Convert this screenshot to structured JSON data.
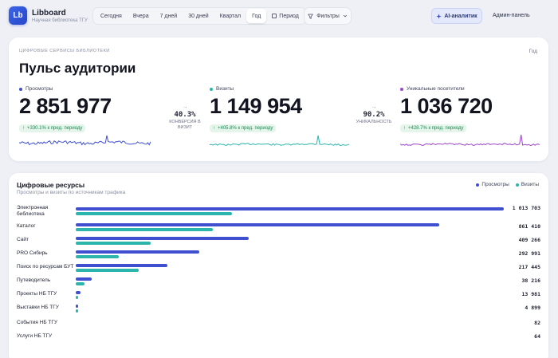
{
  "brand": {
    "logo": "Lb",
    "name": "Libboard",
    "subtitle": "Научная библиотека ТГУ"
  },
  "periods": [
    "Сегодня",
    "Вчера",
    "7 дней",
    "30 дней",
    "Квартал",
    "Год",
    "Период"
  ],
  "active_period": "Год",
  "toolbar": {
    "filters_label": "Фильтры",
    "ai_label": "AI-аналитик",
    "admin_label": "Админ-панель"
  },
  "pulse": {
    "eyebrow": "ЦИФРОВЫЕ СЕРВИСЫ БИБЛИОТЕКИ",
    "period": "Год",
    "title": "Пульс аудитории",
    "metrics": [
      {
        "label": "Просмотры",
        "value": "2 851 977",
        "delta": "+330.1% к пред. периоду",
        "color": "#3f4fd0"
      },
      {
        "label": "Визиты",
        "value": "1 149 954",
        "delta": "+405.8% к пред. периоду",
        "color": "#2bb5ad"
      },
      {
        "label": "Уникальные посетители",
        "value": "1 036 720",
        "delta": "+428.7% к пред. периоду",
        "color": "#9b45c9"
      }
    ],
    "conversions": [
      {
        "arrow": "→",
        "value": "40.3%",
        "label": "КОНВЕРСИЯ В ВИЗИТ"
      },
      {
        "arrow": "→",
        "value": "90.2%",
        "label": "УНИКАЛЬНОСТЬ"
      }
    ]
  },
  "resources": {
    "title": "Цифровые ресурсы",
    "subtitle": "Просмотры и визиты по источникам трафика",
    "legend": {
      "views": "Просмотры",
      "visits": "Визиты"
    },
    "rows": [
      {
        "label": "Электронная библиотека",
        "value": "1 013 703",
        "views": 1.0,
        "visits": 0.365
      },
      {
        "label": "Каталог",
        "value": "861 410",
        "views": 0.85,
        "visits": 0.32
      },
      {
        "label": "Сайт",
        "value": "409 266",
        "views": 0.404,
        "visits": 0.175
      },
      {
        "label": "PRO Сибирь",
        "value": "292 991",
        "views": 0.289,
        "visits": 0.1
      },
      {
        "label": "Поиск по ресурсам БУТ",
        "value": "217 445",
        "views": 0.215,
        "visits": 0.148
      },
      {
        "label": "Путеводитель",
        "value": "38 216",
        "views": 0.038,
        "visits": 0.02
      },
      {
        "label": "Проекты НБ ТГУ",
        "value": "13 981",
        "views": 0.012,
        "visits": 0.006
      },
      {
        "label": "Выставки НБ ТГУ",
        "value": "4 899",
        "views": 0.005,
        "visits": 0.003
      },
      {
        "label": "События НБ ТГУ",
        "value": "82",
        "views": 0,
        "visits": 0
      },
      {
        "label": "Услуги НБ ТГУ",
        "value": "64",
        "views": 0,
        "visits": 0
      }
    ]
  }
}
